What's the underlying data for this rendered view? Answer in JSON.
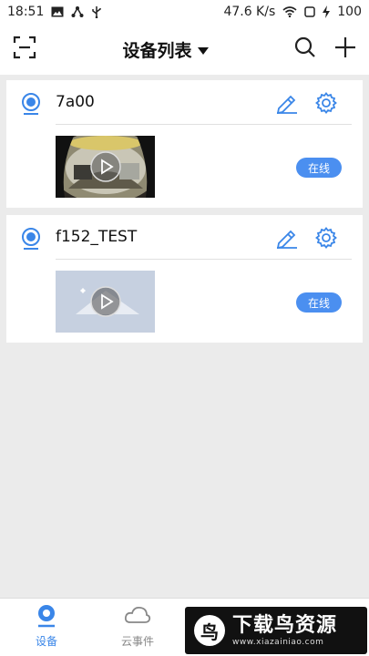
{
  "status_bar": {
    "time": "18:51",
    "net_speed": "47.6 K/s",
    "battery": "100"
  },
  "header": {
    "title": "设备列表"
  },
  "devices": [
    {
      "name": "7a00",
      "status": "在线"
    },
    {
      "name": "f152_TEST",
      "status": "在线"
    }
  ],
  "tabs": [
    {
      "label": "设备",
      "active": true
    },
    {
      "label": "云事件",
      "active": false
    }
  ],
  "watermark": {
    "logo_char": "鸟",
    "title": "下载鸟资源",
    "url": "www.xiazainiao.com"
  },
  "colors": {
    "accent": "#3a86e8",
    "status_online": "#4b8ff0"
  },
  "icons": [
    "scan-icon",
    "search-icon",
    "plus-icon",
    "camera-icon",
    "edit-icon",
    "gear-icon",
    "play-icon",
    "cloud-icon"
  ]
}
